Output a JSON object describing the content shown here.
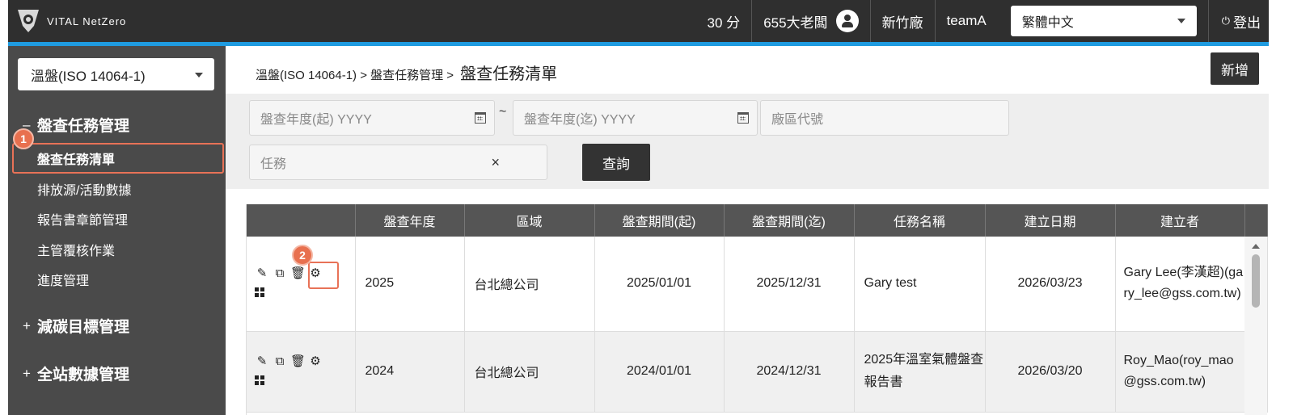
{
  "header": {
    "brand": "VITAL NetZero",
    "score": "30 分",
    "user_name": "655大老闆",
    "factory": "新竹廠",
    "team": "teamA",
    "language": "繁體中文",
    "logout_label": "登出"
  },
  "sidebar": {
    "standard_select": "溫盤(ISO 14064-1)",
    "groups": [
      {
        "sign": "–",
        "label": "盤查任務管理"
      },
      {
        "sign": "+",
        "label": "減碳目標管理"
      },
      {
        "sign": "+",
        "label": "全站數據管理"
      }
    ],
    "items": [
      {
        "label": "盤查任務清單"
      },
      {
        "label": "排放源/活動數據"
      },
      {
        "label": "報告書章節管理"
      },
      {
        "label": "主管覆核作業"
      },
      {
        "label": "進度管理"
      }
    ],
    "step_badge_1": "1"
  },
  "main": {
    "breadcrumb": {
      "path": "溫盤(ISO 14064-1) > 盤查任務管理 >",
      "current": "盤查任務清單"
    },
    "new_label": "新增",
    "filters": {
      "year_start_placeholder": "盤查年度(起) YYYY",
      "year_end_placeholder": "盤查年度(迄) YYYY",
      "tilde": "~",
      "site_code_placeholder": "廠區代號",
      "task_placeholder": "任務",
      "clear_icon": "×",
      "query_label": "查詢"
    },
    "step_badge_2": "2",
    "table": {
      "columns": [
        "",
        "盤查年度",
        "區域",
        "盤查期間(起)",
        "盤查期間(迄)",
        "任務名稱",
        "建立日期",
        "建立者"
      ],
      "rows": [
        {
          "year": "2025",
          "region": "台北總公司",
          "period_start": "2025/01/01",
          "period_end": "2025/12/31",
          "task_name": "Gary test",
          "created_date": "2026/03/23",
          "creator": "Gary Lee(李漢超)(gary_lee@gss.com.tw)"
        },
        {
          "year": "2024",
          "region": "台北總公司",
          "period_start": "2024/01/01",
          "period_end": "2024/12/31",
          "task_name": "2025年溫室氣體盤查報告書",
          "created_date": "2026/03/20",
          "creator": "Roy_Mao(roy_mao@gss.com.tw)"
        }
      ]
    }
  },
  "colors": {
    "topbar": "#2f2f2f",
    "accent": "#1f9be0",
    "sidebar": "#4a4a4a",
    "highlight": "#e87257"
  }
}
